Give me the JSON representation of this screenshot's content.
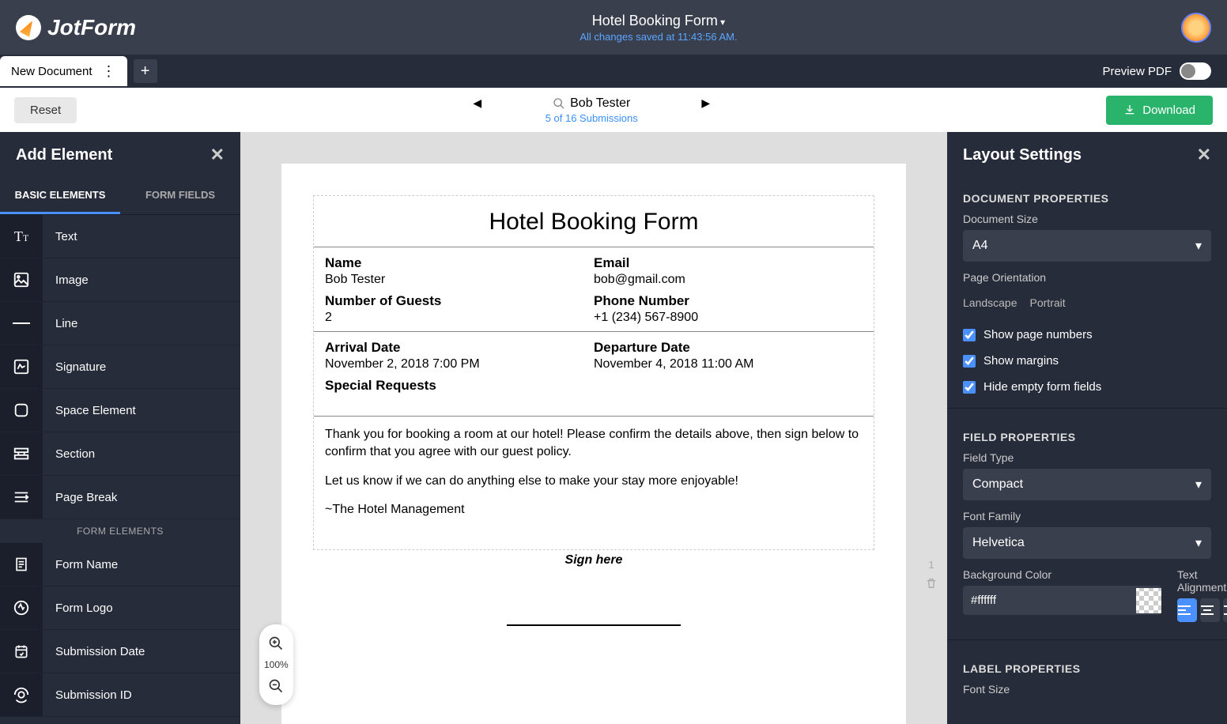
{
  "logo_text": "JotForm",
  "header": {
    "form_title": "Hotel Booking Form",
    "save_status": "All changes saved at 11:43:56 AM."
  },
  "tabs": {
    "doc_tab": "New Document",
    "preview_label": "Preview PDF"
  },
  "toolbar": {
    "reset": "Reset",
    "tester_name": "Bob Tester",
    "submissions": "5 of 16 Submissions",
    "download": "Download"
  },
  "left_panel": {
    "title": "Add Element",
    "tabs": {
      "basic": "BASIC ELEMENTS",
      "form": "FORM FIELDS"
    },
    "items": [
      "Text",
      "Image",
      "Line",
      "Signature",
      "Space Element",
      "Section",
      "Page Break"
    ],
    "form_elements_label": "FORM ELEMENTS",
    "form_items": [
      "Form Name",
      "Form Logo",
      "Submission Date",
      "Submission ID"
    ]
  },
  "zoom": {
    "level": "100%"
  },
  "page_number": "1",
  "document": {
    "title": "Hotel Booking Form",
    "fields": {
      "name_label": "Name",
      "name_value": "Bob Tester",
      "email_label": "Email",
      "email_value": "bob@gmail.com",
      "guests_label": "Number of Guests",
      "guests_value": "2",
      "phone_label": "Phone Number",
      "phone_value": "+1 (234) 567-8900",
      "arrival_label": "Arrival Date",
      "arrival_value": "November 2, 2018 7:00 PM",
      "departure_label": "Departure Date",
      "departure_value": "November 4, 2018 11:00 AM",
      "special_label": "Special Requests"
    },
    "message_p1": "Thank you for booking a room at our hotel! Please confirm the details above, then sign below to confirm that you agree with our guest policy.",
    "message_p2": "Let us know if we can do anything else to make your stay more enjoyable!",
    "message_p3": "~The Hotel Management",
    "sign_here": "Sign here"
  },
  "right_panel": {
    "title": "Layout Settings",
    "doc_props": "DOCUMENT PROPERTIES",
    "doc_size_label": "Document Size",
    "doc_size_value": "A4",
    "orientation_label": "Page Orientation",
    "orientation_landscape": "Landscape",
    "orientation_portrait": "Portrait",
    "check_page_numbers": "Show page numbers",
    "check_margins": "Show margins",
    "check_hide_empty": "Hide empty form fields",
    "field_props": "FIELD PROPERTIES",
    "field_type_label": "Field Type",
    "field_type_value": "Compact",
    "font_family_label": "Font Family",
    "font_family_value": "Helvetica",
    "bg_color_label": "Background Color",
    "bg_color_value": "#ffffff",
    "text_align_label": "Text Alignment",
    "label_props": "LABEL PROPERTIES",
    "font_size_label": "Font Size"
  }
}
